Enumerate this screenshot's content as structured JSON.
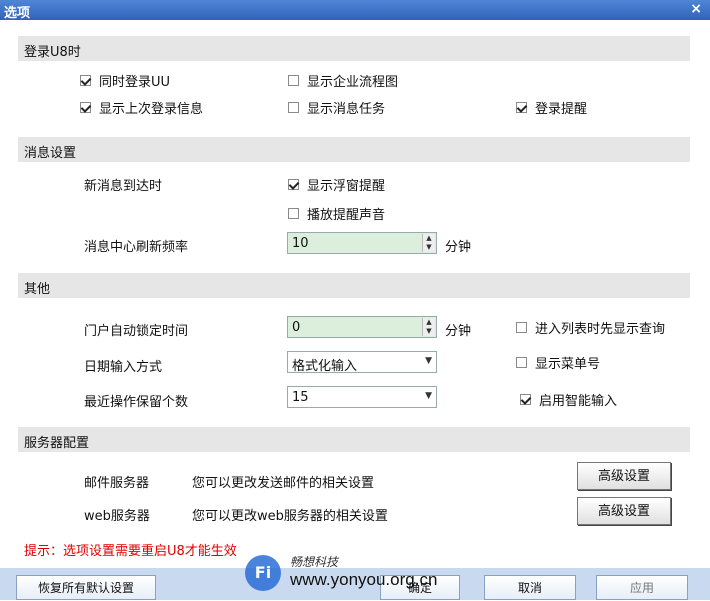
{
  "window": {
    "title": "选项",
    "close_glyph": "×"
  },
  "sections": {
    "login": "登录U8时",
    "message": "消息设置",
    "other": "其他",
    "server": "服务器配置"
  },
  "login": {
    "simultaneous_uu": {
      "label": "同时登录UU",
      "checked": true
    },
    "show_flowchart": {
      "label": "显示企业流程图",
      "checked": false
    },
    "show_last_login": {
      "label": "显示上次登录信息",
      "checked": true
    },
    "show_message_task": {
      "label": "显示消息任务",
      "checked": false
    },
    "login_reminder": {
      "label": "登录提醒",
      "checked": true
    }
  },
  "message": {
    "arrival_label": "新消息到达时",
    "show_popup": {
      "label": "显示浮窗提醒",
      "checked": true
    },
    "play_sound": {
      "label": "播放提醒声音",
      "checked": false
    },
    "refresh_label": "消息中心刷新频率",
    "refresh_value": "10",
    "refresh_unit": "分钟"
  },
  "other": {
    "autolock_label": "门户自动锁定时间",
    "autolock_value": "0",
    "autolock_unit": "分钟",
    "date_input_label": "日期输入方式",
    "date_input_value": "格式化输入",
    "recent_ops_label": "最近操作保留个数",
    "recent_ops_value": "15",
    "list_query": {
      "label": "进入列表时先显示查询",
      "checked": false
    },
    "show_menu_no": {
      "label": "显示菜单号",
      "checked": false
    },
    "smart_input": {
      "label": "启用智能输入",
      "checked": true
    }
  },
  "server": {
    "mail_label": "邮件服务器",
    "mail_desc": "您可以更改发送邮件的相关设置",
    "mail_button": "高级设置",
    "web_label": "web服务器",
    "web_desc": "您可以更改web服务器的相关设置",
    "web_button": "高级设置"
  },
  "hint": "提示：选项设置需要重启U8才能生效",
  "footer": {
    "restore_defaults": "恢复所有默认设置",
    "ok": "确定",
    "cancel": "取消",
    "apply": "应用"
  },
  "watermark": {
    "logo_text": "Fi",
    "cn_text": "畅想科技",
    "url": "www.yonyou.org.cn"
  }
}
